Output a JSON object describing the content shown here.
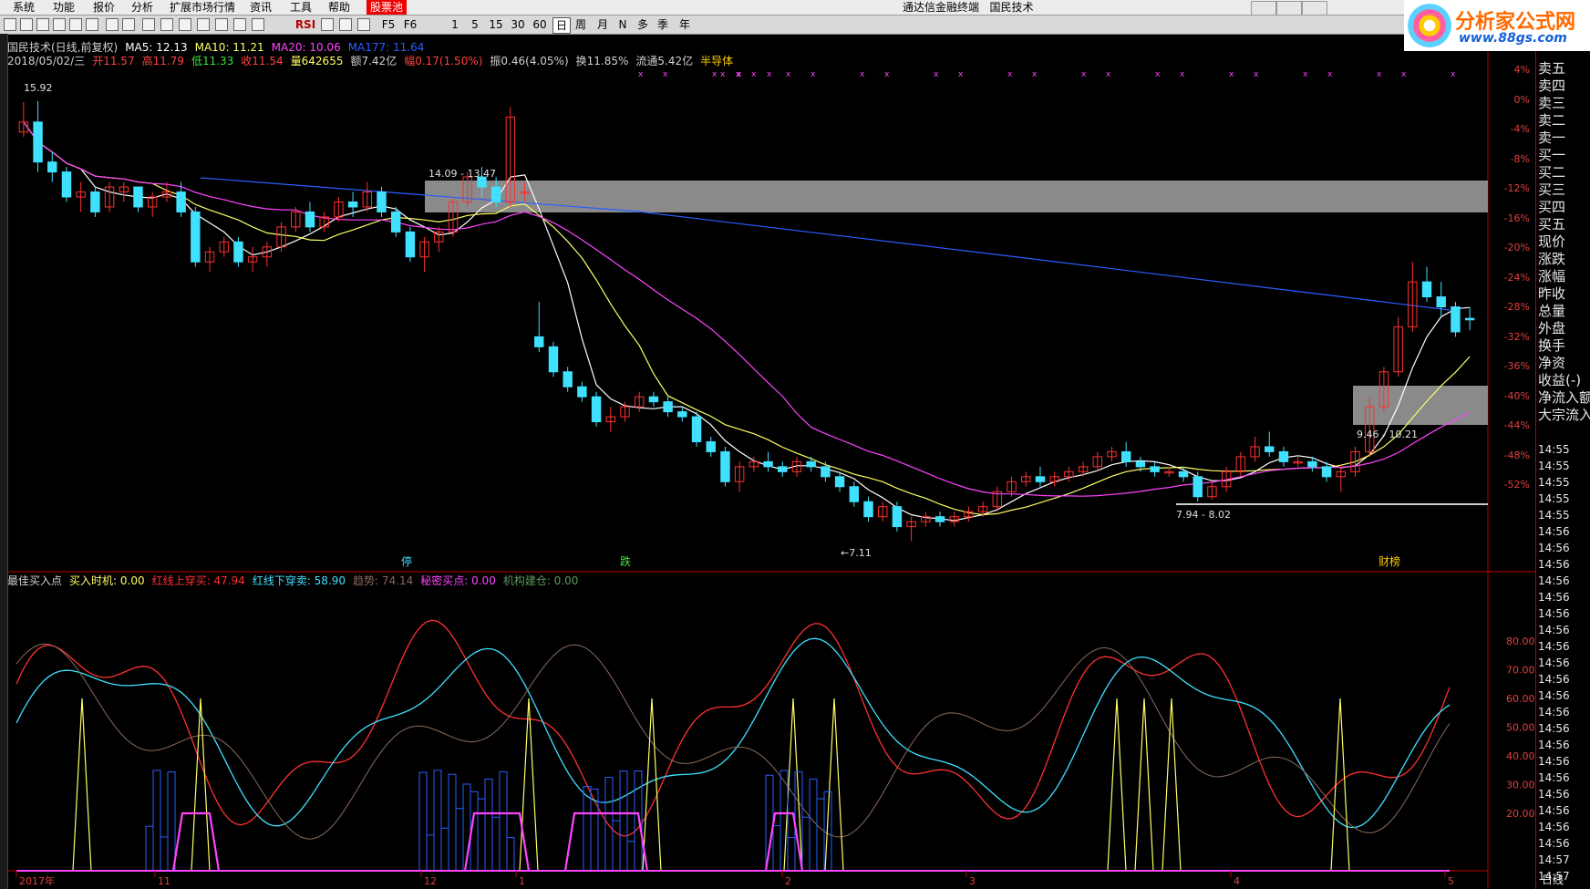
{
  "menu": [
    "系统",
    "功能",
    "报价",
    "分析",
    "扩展市场行情",
    "资讯",
    "工具",
    "帮助",
    "股票池"
  ],
  "app_title": "通达信金融终端",
  "stock_name_title": "国民技术",
  "toolbar": [
    "F5",
    "F6",
    "1",
    "5",
    "15",
    "30",
    "60",
    "日",
    "周",
    "月",
    "N",
    "多",
    "季",
    "年"
  ],
  "logo": {
    "main": "分析家公式网",
    "url": "www.88gs.com"
  },
  "info_line1": [
    {
      "text": "国民技术(日线,前复权)",
      "color": "#d0d0d0"
    },
    {
      "text": "MA5: 12.13",
      "color": "#ffffff"
    },
    {
      "text": "MA10: 11.21",
      "color": "#ffff66"
    },
    {
      "text": "MA20: 10.06",
      "color": "#ff44ff"
    },
    {
      "text": "MA177: 11.64",
      "color": "#2a5fff"
    }
  ],
  "info_line2": [
    {
      "text": "2018/05/02/三",
      "color": "#d0d0d0"
    },
    {
      "text": "开11.57",
      "color": "#ff4040"
    },
    {
      "text": "高11.79",
      "color": "#ff4040"
    },
    {
      "text": "低11.33",
      "color": "#40e040"
    },
    {
      "text": "收11.54",
      "color": "#ff4040"
    },
    {
      "text": "量642655",
      "color": "#ffff66"
    },
    {
      "text": "额7.42亿",
      "color": "#d0d0d0"
    },
    {
      "text": "幅0.17(1.50%)",
      "color": "#ff4040"
    },
    {
      "text": "振0.46(4.05%)",
      "color": "#d0d0d0"
    },
    {
      "text": "换11.85%",
      "color": "#d0d0d0"
    },
    {
      "text": "流通5.42亿",
      "color": "#d0d0d0"
    },
    {
      "text": "半导体",
      "color": "#ffcc00"
    }
  ],
  "indicator_line": [
    {
      "text": "最佳买入点",
      "color": "#d0d0d0"
    },
    {
      "text": "买入时机: 0.00",
      "color": "#ffff66"
    },
    {
      "text": "红线上穿买: 47.94",
      "color": "#ff3030"
    },
    {
      "text": "红线下穿卖: 58.90",
      "color": "#40e0ff"
    },
    {
      "text": "趋势: 74.14",
      "color": "#8a6a5a"
    },
    {
      "text": "秘密买点: 0.00",
      "color": "#ff44ff"
    },
    {
      "text": "机构建仓: 0.00",
      "color": "#5a9a5a"
    }
  ],
  "price_labels": {
    "high": "15.92",
    "low": "7.11",
    "box1": "14.09 - 13.47",
    "box2": "9.46 - 10.21",
    "box3": "7.94 - 8.02"
  },
  "event_tags": [
    "停",
    "跌",
    "财榜"
  ],
  "pct_axis": [
    "4%",
    "0%",
    "-4%",
    "-8%",
    "-12%",
    "-16%",
    "-20%",
    "-24%",
    "-28%",
    "-32%",
    "-36%",
    "-40%",
    "-44%",
    "-48%",
    "-52%"
  ],
  "ind_axis": [
    "80.00",
    "70.00",
    "60.00",
    "50.00",
    "40.00",
    "30.00",
    "20.00"
  ],
  "date_axis": [
    "2017年",
    "11",
    "12",
    "1",
    "2",
    "3",
    "4",
    "5"
  ],
  "period_label": "日线",
  "right_panel": [
    "卖五",
    "卖四",
    "卖三",
    "卖二",
    "卖一",
    "买一",
    "买二",
    "买三",
    "买四",
    "买五",
    "现价",
    "涨跌",
    "涨幅",
    "昨收",
    "总量",
    "外盘",
    "换手",
    "净资",
    "收益(-)",
    "净流入额",
    "大宗流入"
  ],
  "time_list": [
    "14:55",
    "14:55",
    "14:55",
    "14:55",
    "14:55",
    "14:56",
    "14:56",
    "14:56",
    "14:56",
    "14:56",
    "14:56",
    "14:56",
    "14:56",
    "14:56",
    "14:56",
    "14:56",
    "14:56",
    "14:56",
    "14:56",
    "14:56",
    "14:56",
    "14:56",
    "14:56",
    "14:56",
    "14:56",
    "14:57",
    "14:57"
  ],
  "colors": {
    "up": "#ff3030",
    "down": "#40e0ff",
    "ma5": "#ffffff",
    "ma10": "#ffff66",
    "ma20": "#ff44ff",
    "ma177": "#2a5fff"
  },
  "chart_data": {
    "type": "candlestick",
    "ohlc": [
      [
        15.3,
        15.9,
        15.2,
        15.5
      ],
      [
        15.5,
        15.92,
        14.5,
        14.7
      ],
      [
        14.7,
        14.9,
        14.3,
        14.5
      ],
      [
        14.5,
        14.6,
        13.9,
        14.0
      ],
      [
        14.0,
        14.3,
        13.7,
        14.1
      ],
      [
        14.1,
        14.2,
        13.6,
        13.7
      ],
      [
        13.8,
        14.3,
        13.7,
        14.2
      ],
      [
        14.1,
        14.3,
        13.9,
        14.2
      ],
      [
        14.2,
        14.2,
        13.7,
        13.8
      ],
      [
        13.8,
        14.1,
        13.6,
        14.0
      ],
      [
        14.0,
        14.3,
        13.9,
        14.1
      ],
      [
        14.1,
        14.3,
        13.6,
        13.7
      ],
      [
        13.7,
        13.8,
        12.6,
        12.7
      ],
      [
        12.7,
        13.0,
        12.5,
        12.9
      ],
      [
        12.9,
        13.2,
        12.8,
        13.1
      ],
      [
        13.1,
        13.2,
        12.6,
        12.7
      ],
      [
        12.7,
        13.0,
        12.5,
        12.8
      ],
      [
        12.8,
        13.1,
        12.6,
        13.0
      ],
      [
        13.0,
        13.5,
        12.9,
        13.4
      ],
      [
        13.4,
        13.8,
        13.3,
        13.7
      ],
      [
        13.7,
        13.9,
        13.3,
        13.4
      ],
      [
        13.4,
        13.7,
        13.3,
        13.6
      ],
      [
        13.6,
        14.0,
        13.5,
        13.9
      ],
      [
        13.9,
        14.1,
        13.6,
        13.8
      ],
      [
        13.8,
        14.3,
        13.7,
        14.1
      ],
      [
        14.1,
        14.2,
        13.6,
        13.7
      ],
      [
        13.7,
        13.8,
        13.2,
        13.3
      ],
      [
        13.3,
        13.4,
        12.7,
        12.8
      ],
      [
        12.8,
        13.2,
        12.5,
        13.1
      ],
      [
        13.1,
        13.4,
        12.9,
        13.3
      ],
      [
        13.3,
        14.0,
        13.2,
        13.9
      ],
      [
        13.9,
        14.5,
        13.8,
        14.4
      ],
      [
        14.4,
        14.6,
        14.0,
        14.2
      ],
      [
        14.2,
        14.4,
        13.8,
        13.9
      ],
      [
        13.9,
        15.8,
        13.8,
        15.6
      ],
      [
        14.1,
        14.3,
        13.9,
        14.1
      ],
      [
        11.2,
        11.9,
        10.9,
        11.0
      ],
      [
        11.0,
        11.1,
        10.4,
        10.5
      ],
      [
        10.5,
        10.6,
        10.1,
        10.2
      ],
      [
        10.2,
        10.3,
        9.9,
        10.0
      ],
      [
        10.0,
        10.1,
        9.4,
        9.5
      ],
      [
        9.5,
        9.8,
        9.3,
        9.6
      ],
      [
        9.6,
        9.9,
        9.5,
        9.8
      ],
      [
        9.8,
        10.1,
        9.7,
        10.0
      ],
      [
        10.0,
        10.1,
        9.8,
        9.9
      ],
      [
        9.9,
        10.0,
        9.6,
        9.7
      ],
      [
        9.7,
        9.8,
        9.5,
        9.6
      ],
      [
        9.6,
        9.7,
        9.0,
        9.1
      ],
      [
        9.1,
        9.2,
        8.8,
        8.9
      ],
      [
        8.9,
        9.0,
        8.2,
        8.3
      ],
      [
        8.3,
        8.7,
        8.1,
        8.6
      ],
      [
        8.6,
        8.8,
        8.5,
        8.7
      ],
      [
        8.7,
        8.9,
        8.5,
        8.6
      ],
      [
        8.6,
        8.7,
        8.4,
        8.5
      ],
      [
        8.5,
        8.8,
        8.4,
        8.7
      ],
      [
        8.7,
        8.8,
        8.5,
        8.6
      ],
      [
        8.6,
        8.7,
        8.3,
        8.4
      ],
      [
        8.4,
        8.5,
        8.1,
        8.2
      ],
      [
        8.2,
        8.3,
        7.8,
        7.9
      ],
      [
        7.9,
        8.0,
        7.5,
        7.6
      ],
      [
        7.6,
        7.9,
        7.5,
        7.8
      ],
      [
        7.8,
        7.9,
        7.3,
        7.4
      ],
      [
        7.4,
        7.6,
        7.11,
        7.5
      ],
      [
        7.5,
        7.7,
        7.4,
        7.6
      ],
      [
        7.6,
        7.7,
        7.4,
        7.5
      ],
      [
        7.5,
        7.7,
        7.4,
        7.6
      ],
      [
        7.6,
        7.8,
        7.5,
        7.7
      ],
      [
        7.7,
        7.9,
        7.6,
        7.8
      ],
      [
        7.8,
        8.2,
        7.7,
        8.1
      ],
      [
        8.1,
        8.4,
        8.0,
        8.3
      ],
      [
        8.3,
        8.5,
        8.2,
        8.4
      ],
      [
        8.4,
        8.6,
        8.2,
        8.3
      ],
      [
        8.3,
        8.5,
        8.2,
        8.4
      ],
      [
        8.4,
        8.6,
        8.3,
        8.5
      ],
      [
        8.5,
        8.7,
        8.4,
        8.6
      ],
      [
        8.6,
        8.9,
        8.5,
        8.8
      ],
      [
        8.8,
        9.0,
        8.7,
        8.9
      ],
      [
        8.9,
        9.1,
        8.6,
        8.7
      ],
      [
        8.7,
        8.8,
        8.5,
        8.6
      ],
      [
        8.6,
        8.7,
        8.4,
        8.5
      ],
      [
        8.5,
        8.6,
        8.4,
        8.5
      ],
      [
        8.5,
        8.6,
        8.3,
        8.4
      ],
      [
        8.4,
        8.5,
        7.9,
        8.0
      ],
      [
        8.0,
        8.3,
        7.94,
        8.2
      ],
      [
        8.2,
        8.6,
        8.1,
        8.5
      ],
      [
        8.5,
        8.9,
        8.4,
        8.8
      ],
      [
        8.8,
        9.2,
        8.7,
        9.0
      ],
      [
        9.0,
        9.3,
        8.8,
        8.9
      ],
      [
        8.9,
        9.0,
        8.6,
        8.7
      ],
      [
        8.7,
        8.8,
        8.6,
        8.7
      ],
      [
        8.7,
        8.8,
        8.5,
        8.6
      ],
      [
        8.6,
        8.7,
        8.3,
        8.4
      ],
      [
        8.4,
        8.6,
        8.1,
        8.5
      ],
      [
        8.5,
        9.0,
        8.4,
        8.9
      ],
      [
        8.9,
        10.0,
        8.8,
        9.8
      ],
      [
        9.8,
        10.6,
        9.7,
        10.5
      ],
      [
        10.5,
        11.6,
        10.4,
        11.4
      ],
      [
        11.4,
        12.7,
        11.3,
        12.3
      ],
      [
        12.3,
        12.6,
        11.9,
        12.0
      ],
      [
        12.0,
        12.3,
        11.6,
        11.8
      ],
      [
        11.8,
        11.9,
        11.2,
        11.3
      ],
      [
        11.57,
        11.79,
        11.33,
        11.54
      ]
    ],
    "ma5": 12.13,
    "ma10": 11.21,
    "ma20": 10.06,
    "ma177": 11.64,
    "indicator": {
      "buy_timing": 0.0,
      "red_up": 47.94,
      "red_down": 58.9,
      "trend": 74.14,
      "secret_buy": 0.0,
      "inst_build": 0.0
    },
    "ind_ylim": [
      0,
      100
    ]
  }
}
